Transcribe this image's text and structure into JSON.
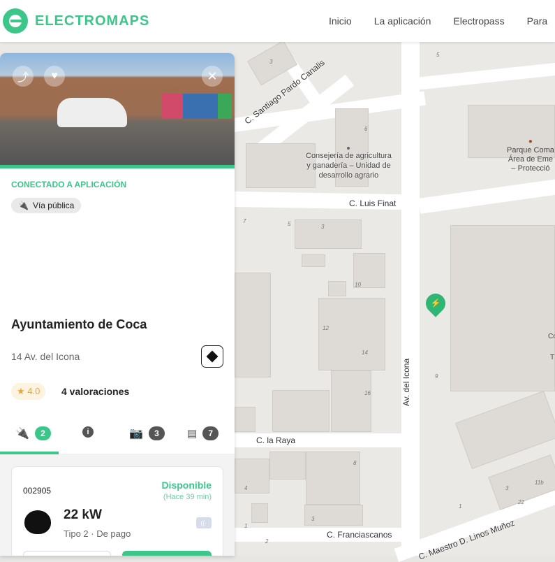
{
  "header": {
    "brand": "ELECTROMAPS",
    "nav": [
      "Inicio",
      "La aplicación",
      "Electropass",
      "Para"
    ]
  },
  "map": {
    "streets": [
      "C. Santiago Pardo Canalis",
      "C. Luis Finat",
      "Av. del Icona",
      "C. la Raya",
      "C. Franciascanos",
      "C. Maestro D. Linos Muñoz"
    ],
    "poi1": [
      "Consejería de agricultura",
      "y ganadería – Unidad de",
      "desarrollo agrario"
    ],
    "poi2": [
      "Parque Coma",
      "Área de Eme",
      "– Protecció"
    ],
    "numbers": [
      "3",
      "5",
      "6",
      "5",
      "3",
      "7",
      "10",
      "12",
      "14",
      "16",
      "8",
      "4",
      "3",
      "2",
      "9",
      "3",
      "11b",
      "22",
      "1",
      "1",
      "Co",
      "T"
    ],
    "marker_color": "#2fb574"
  },
  "panel": {
    "connected": "CONECTADO A APLICACIÓN",
    "chip": "Vía pública",
    "title": "Ayuntamiento de Coca",
    "address": "14 Av. del Icona",
    "rating": "4.0",
    "reviews": "4 valoraciones",
    "tabs": {
      "chargers": "2",
      "photos": "3",
      "comments": "7"
    },
    "charger": {
      "id": "002905",
      "status": "Disponible",
      "updated": "(Hace 39 min)",
      "power": "22 kW",
      "detail": "Tipo 2 · De pago"
    }
  },
  "colors": {
    "accent": "#3cc68a"
  }
}
